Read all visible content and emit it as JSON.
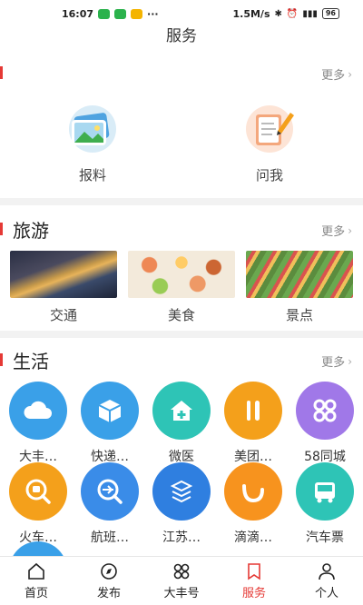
{
  "status_bar": {
    "time": "16:07",
    "dots": "···",
    "speed": "1.5M/s",
    "battery": "96"
  },
  "page": {
    "title": "服务"
  },
  "top_section": {
    "more_label": "更多",
    "items": [
      {
        "label": "报料",
        "icon": "photo-icon"
      },
      {
        "label": "问我",
        "icon": "notepad-pencil-icon"
      }
    ]
  },
  "travel": {
    "title": "旅游",
    "more_label": "更多",
    "items": [
      {
        "label": "交通",
        "image": "city-traffic-photo"
      },
      {
        "label": "美食",
        "image": "food-photo"
      },
      {
        "label": "景点",
        "image": "terraced-fields-photo"
      }
    ]
  },
  "life": {
    "title": "生活",
    "more_label": "更多",
    "items": [
      {
        "label": "大丰…",
        "icon": "cloud-icon",
        "color": "#3aa0e8"
      },
      {
        "label": "快递…",
        "icon": "package-icon",
        "color": "#3aa0e8"
      },
      {
        "label": "微医",
        "icon": "medical-house-icon",
        "color": "#2ec4b6"
      },
      {
        "label": "美团…",
        "icon": "utensils-icon",
        "color": "#f4a01b"
      },
      {
        "label": "58同城",
        "icon": "grid-icon",
        "color": "#a078e8"
      },
      {
        "label": "火车…",
        "icon": "train-search-icon",
        "color": "#f4a01b"
      },
      {
        "label": "航班…",
        "icon": "plane-search-icon",
        "color": "#3a8ce8"
      },
      {
        "label": "江苏…",
        "icon": "network-icon",
        "color": "#2f7fe0"
      },
      {
        "label": "滴滴…",
        "icon": "didi-icon",
        "color": "#f7931e"
      },
      {
        "label": "汽车票",
        "icon": "bus-icon",
        "color": "#2ec4b6"
      }
    ]
  },
  "tab_bar": {
    "tabs": [
      {
        "label": "首页",
        "icon": "home-icon"
      },
      {
        "label": "发布",
        "icon": "compass-icon"
      },
      {
        "label": "大丰号",
        "icon": "grid-icon"
      },
      {
        "label": "服务",
        "icon": "bookmark-icon",
        "active": true
      },
      {
        "label": "个人",
        "icon": "person-icon"
      }
    ]
  },
  "colors": {
    "accent": "#e53935",
    "divider": "#f2f2f2"
  }
}
